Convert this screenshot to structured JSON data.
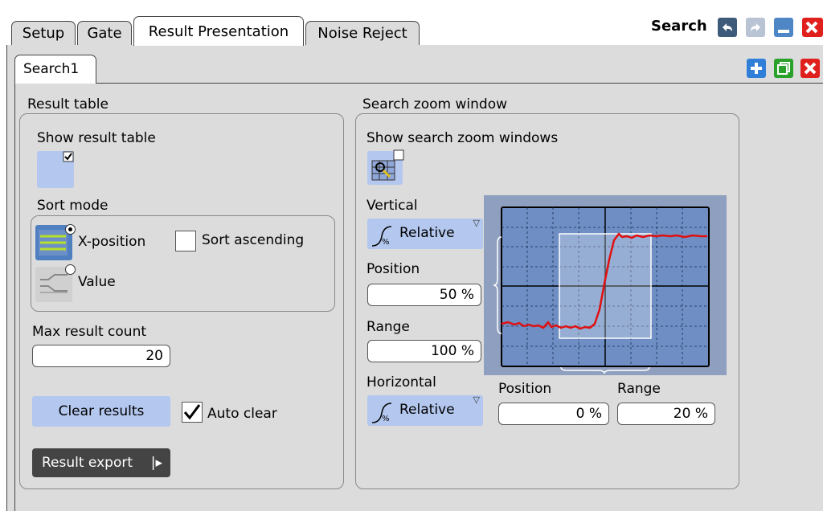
{
  "window": {
    "title": "Search"
  },
  "tabs": [
    {
      "label": "Setup"
    },
    {
      "label": "Gate"
    },
    {
      "label": "Result Presentation"
    },
    {
      "label": "Noise Reject"
    }
  ],
  "subtab": {
    "label": "Search1"
  },
  "result_table": {
    "title": "Result table",
    "show_label": "Show result table",
    "show_checked": true,
    "sort_mode_label": "Sort mode",
    "sort_options": [
      {
        "label": "X-position",
        "selected": true
      },
      {
        "label": "Value",
        "selected": false
      }
    ],
    "sort_ascending_label": "Sort ascending",
    "sort_ascending_checked": false,
    "max_count_label": "Max result count",
    "max_count_value": "20",
    "clear_label": "Clear results",
    "auto_clear_label": "Auto clear",
    "auto_clear_checked": true,
    "export_label": "Result export"
  },
  "zoom": {
    "title": "Search zoom window",
    "show_label": "Show search zoom windows",
    "show_checked": false,
    "vertical_label": "Vertical",
    "vertical_mode": "Relative",
    "v_position_label": "Position",
    "v_position_value": "50 %",
    "v_range_label": "Range",
    "v_range_value": "100 %",
    "horizontal_label": "Horizontal",
    "horizontal_mode": "Relative",
    "h_position_label": "Position",
    "h_position_value": "0 %",
    "h_range_label": "Range",
    "h_range_value": "20 %"
  },
  "colors": {
    "accent": "#b3c7ef",
    "panel": "#dcdcdc",
    "close_red": "#e0201c",
    "add_blue": "#2f7fd8",
    "copy_green": "#2aa12a",
    "trace_red": "#e01010",
    "screen_bg": "#8f9fbf"
  }
}
